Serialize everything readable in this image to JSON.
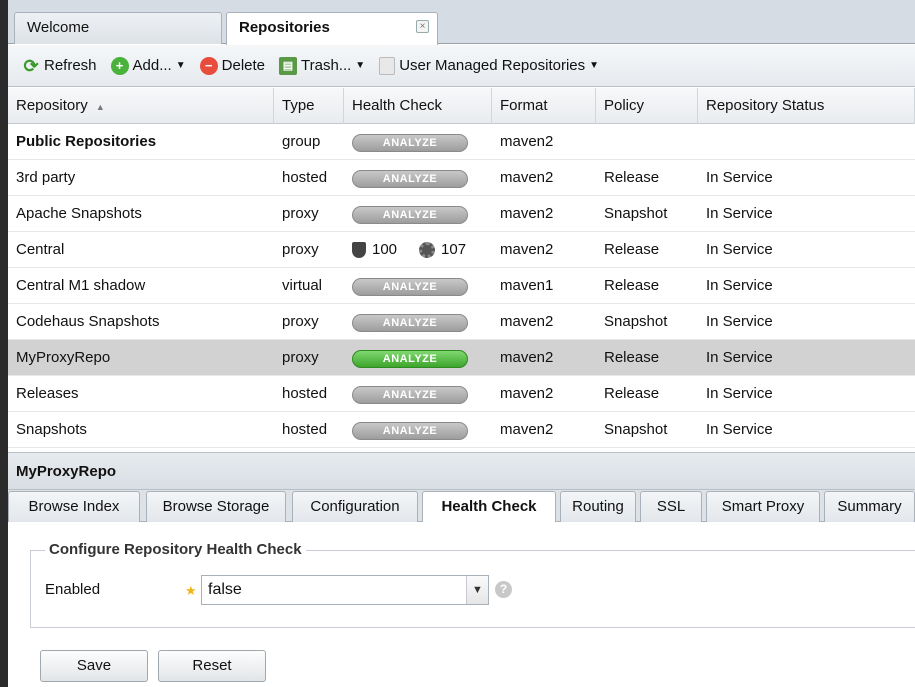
{
  "tabs": [
    {
      "label": "Welcome"
    },
    {
      "label": "Repositories",
      "close": "×"
    }
  ],
  "toolbar": {
    "refresh": "Refresh",
    "add": "Add...",
    "delete": "Delete",
    "trash": "Trash...",
    "user_managed": "User Managed Repositories"
  },
  "grid": {
    "headers": [
      "Repository",
      "Type",
      "Health Check",
      "Format",
      "Policy",
      "Repository Status"
    ],
    "sort_indicator": "▲",
    "analyze_label": "ANALYZE",
    "rows": [
      {
        "name": "Public Repositories",
        "type": "group",
        "format": "maven2",
        "policy": "",
        "status": ""
      },
      {
        "name": "3rd party",
        "type": "hosted",
        "format": "maven2",
        "policy": "Release",
        "status": "In Service"
      },
      {
        "name": "Apache Snapshots",
        "type": "proxy",
        "format": "maven2",
        "policy": "Snapshot",
        "status": "In Service"
      },
      {
        "name": "Central",
        "type": "proxy",
        "format": "maven2",
        "policy": "Release",
        "status": "In Service",
        "security": "100",
        "license": "107"
      },
      {
        "name": "Central M1 shadow",
        "type": "virtual",
        "format": "maven1",
        "policy": "Release",
        "status": "In Service"
      },
      {
        "name": "Codehaus Snapshots",
        "type": "proxy",
        "format": "maven2",
        "policy": "Snapshot",
        "status": "In Service"
      },
      {
        "name": "MyProxyRepo",
        "type": "proxy",
        "format": "maven2",
        "policy": "Release",
        "status": "In Service"
      },
      {
        "name": "Releases",
        "type": "hosted",
        "format": "maven2",
        "policy": "Release",
        "status": "In Service"
      },
      {
        "name": "Snapshots",
        "type": "hosted",
        "format": "maven2",
        "policy": "Snapshot",
        "status": "In Service"
      }
    ]
  },
  "detail": {
    "title": "MyProxyRepo",
    "subtabs": [
      "Browse Index",
      "Browse Storage",
      "Configuration",
      "Health Check",
      "Routing",
      "SSL",
      "Smart Proxy",
      "Summary"
    ],
    "legend": "Configure Repository Health Check",
    "enabled_label": "Enabled",
    "enabled_value": "false",
    "save": "Save",
    "reset": "Reset"
  }
}
